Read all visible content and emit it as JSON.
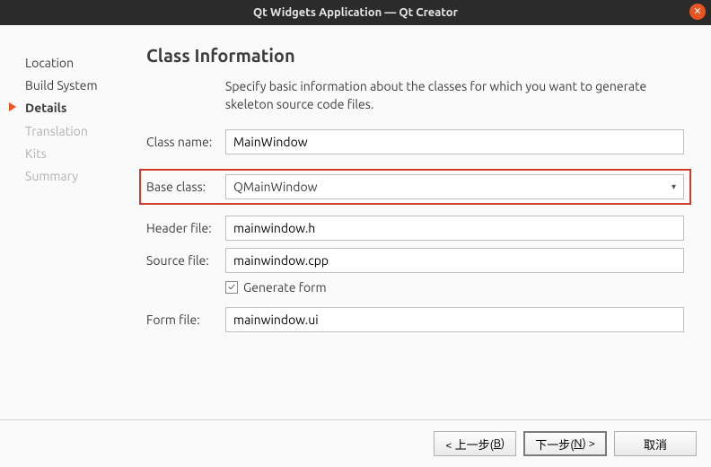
{
  "window": {
    "title": "Qt Widgets Application — Qt Creator"
  },
  "sidebar": {
    "steps": {
      "location": "Location",
      "build_system": "Build System",
      "details": "Details",
      "translation": "Translation",
      "kits": "Kits",
      "summary": "Summary"
    }
  },
  "main": {
    "heading": "Class Information",
    "description": "Specify basic information about the classes for which you want to generate skeleton source code files.",
    "labels": {
      "class_name": "Class name:",
      "base_class": "Base class:",
      "header_file": "Header file:",
      "source_file": "Source file:",
      "form_file": "Form file:",
      "generate_form": "Generate form"
    },
    "values": {
      "class_name": "MainWindow",
      "base_class": "QMainWindow",
      "header_file": "mainwindow.h",
      "source_file": "mainwindow.cpp",
      "form_file": "mainwindow.ui"
    }
  },
  "footer": {
    "back_pre": "< 上一步(",
    "back_mn": "B",
    "back_post": ")",
    "next_pre": "下一步(",
    "next_mn": "N",
    "next_post": ") >",
    "cancel": "取消"
  }
}
